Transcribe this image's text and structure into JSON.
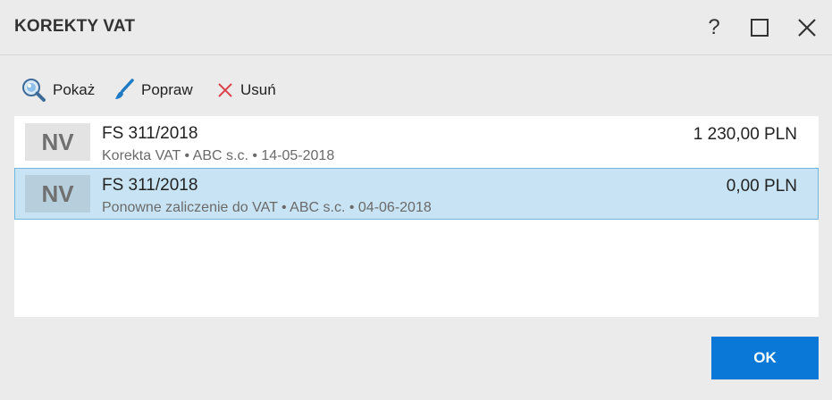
{
  "window": {
    "title": "KOREKTY VAT",
    "help_label": "?"
  },
  "toolbar": {
    "show_label": "Pokaż",
    "fix_label": "Popraw",
    "delete_label": "Usuń"
  },
  "list": {
    "rows": [
      {
        "badge": "NV",
        "doc_number": "FS 311/2018",
        "description": "Korekta VAT • ABC s.c. • 14-05-2018",
        "amount": "1 230,00 PLN",
        "selected": false
      },
      {
        "badge": "NV",
        "doc_number": "FS 311/2018",
        "description": "Ponowne zaliczenie do VAT • ABC s.c. • 04-06-2018",
        "amount": "0,00 PLN",
        "selected": true
      }
    ]
  },
  "footer": {
    "ok_label": "OK"
  },
  "colors": {
    "accent": "#0a78d6",
    "selection": "#c8e4f4",
    "delete_icon": "#d9414b",
    "brush_icon": "#1e7bc4"
  }
}
